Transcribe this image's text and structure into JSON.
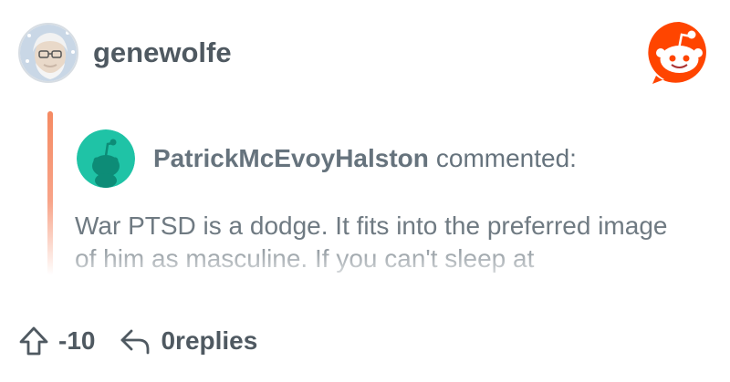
{
  "post": {
    "username": "genewolfe",
    "avatar_icon": "user-avatar-illustration",
    "logo_icon": "reddit-logo-icon"
  },
  "quoted_comment": {
    "commenter": "PatrickMcEvoyHalston",
    "verb": "commented:",
    "text": "War PTSD is a dodge. It fits into the preferred image of him as masculine. If you can't sleep at",
    "avatar_icon": "snoo-avatar",
    "accent_color": "#f58a62"
  },
  "footer": {
    "score": "-10",
    "replies": "0replies",
    "upvote_icon": "upvote-arrow-icon",
    "reply_icon": "reply-arrow-icon"
  }
}
